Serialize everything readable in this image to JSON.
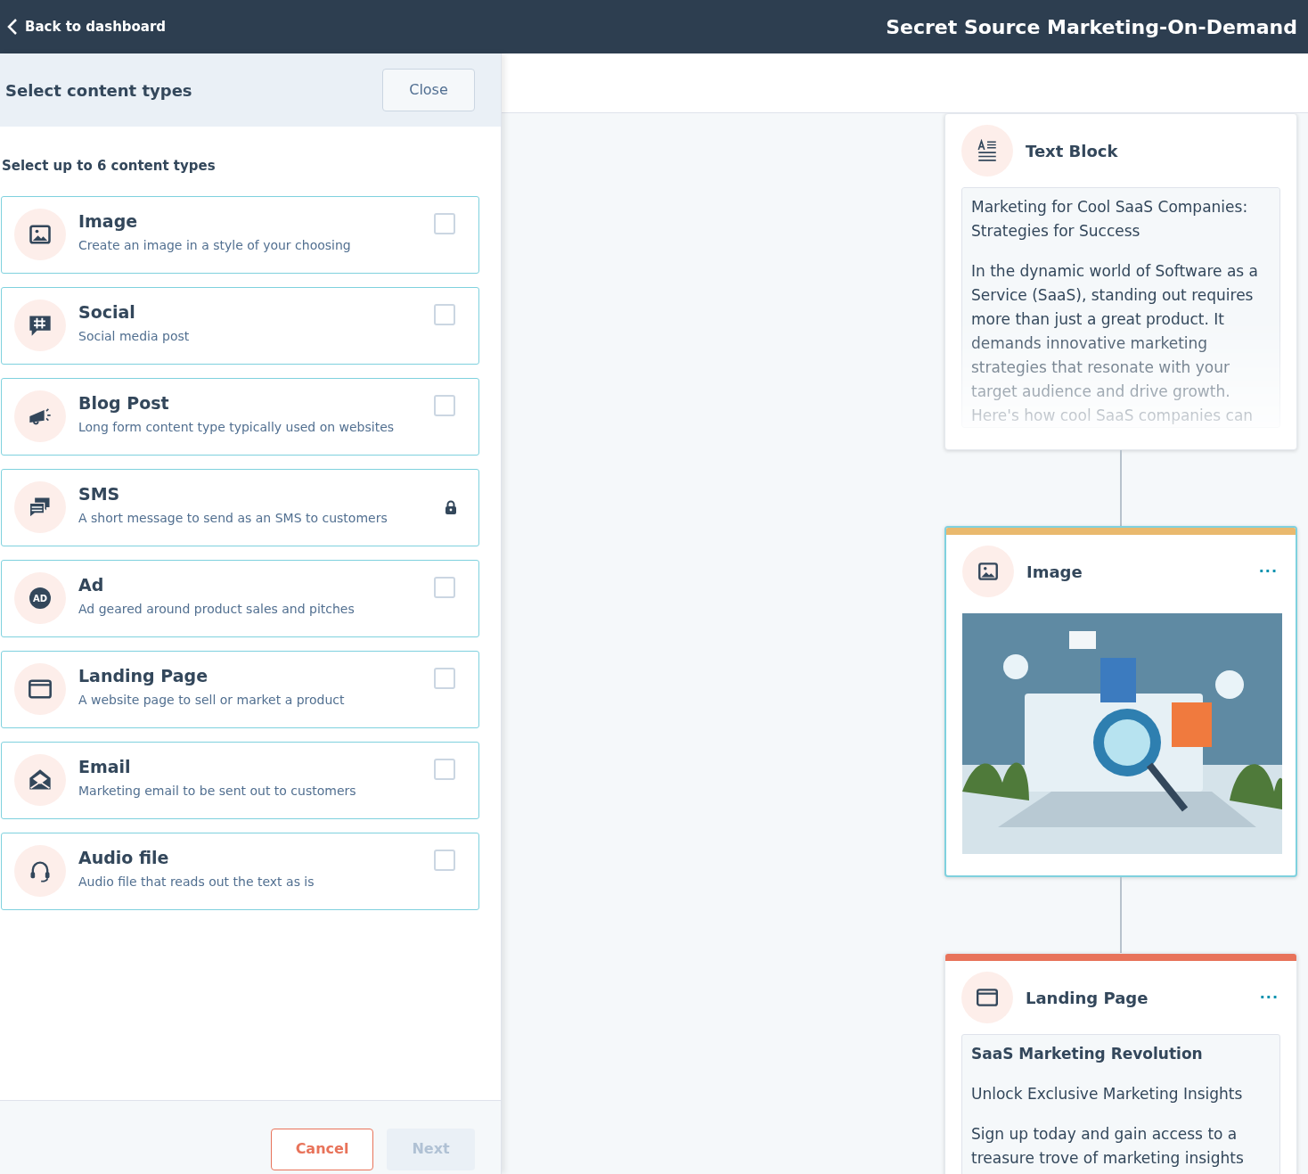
{
  "header": {
    "back_link": "Back to dashboard",
    "title": "Secret Source Marketing-On-Demand"
  },
  "panel": {
    "title": "Select content types",
    "close_button": "Close",
    "instruction": "Select up to 6 content types",
    "items": [
      {
        "title": "Image",
        "description": "Create an image in a style of your choosing",
        "kind": "checkbox",
        "checked": false
      },
      {
        "title": "Social",
        "description": "Social media post",
        "kind": "checkbox",
        "checked": false
      },
      {
        "title": "Blog Post",
        "description": "Long form content type typically used on websites",
        "kind": "checkbox",
        "checked": false
      },
      {
        "title": "SMS",
        "description": "A short message to send as an SMS to customers",
        "kind": "locked"
      },
      {
        "icon_label": "AD",
        "title": "Ad",
        "description": "Ad geared around product sales and pitches",
        "kind": "checkbox",
        "checked": false
      },
      {
        "title": "Landing Page",
        "description": "A website page to sell or market a product",
        "kind": "checkbox",
        "checked": false
      },
      {
        "title": "Email",
        "description": "Marketing email to be sent out to customers",
        "kind": "checkbox",
        "checked": false
      },
      {
        "title": "Audio file",
        "description": "Audio file that reads out the text as is",
        "kind": "checkbox",
        "checked": false
      }
    ],
    "cancel_button": "Cancel",
    "next_button": {
      "label": "Next",
      "disabled": true
    }
  },
  "canvas": {
    "cards": [
      {
        "title": "Text Block",
        "kind": "text",
        "selected": false,
        "paragraphs": [
          "Marketing for Cool SaaS Companies: Strategies for Success",
          "In the dynamic world of Software as a Service (SaaS), standing out requires more than just a great product. It demands innovative marketing strategies that resonate with your target audience and drive growth. Here's how cool SaaS companies can"
        ]
      },
      {
        "title": "Image",
        "kind": "picture",
        "selected": true,
        "menu_label": "···",
        "color": "#e9b96e"
      },
      {
        "title": "Landing Page",
        "kind": "landing",
        "selected": false,
        "menu_label": "···",
        "color": "#e8735a",
        "headline": "SaaS Marketing Revolution",
        "paragraphs": [
          "Unlock Exclusive Marketing Insights",
          "Sign up today and gain access to a treasure trove of marketing insights"
        ]
      }
    ]
  }
}
